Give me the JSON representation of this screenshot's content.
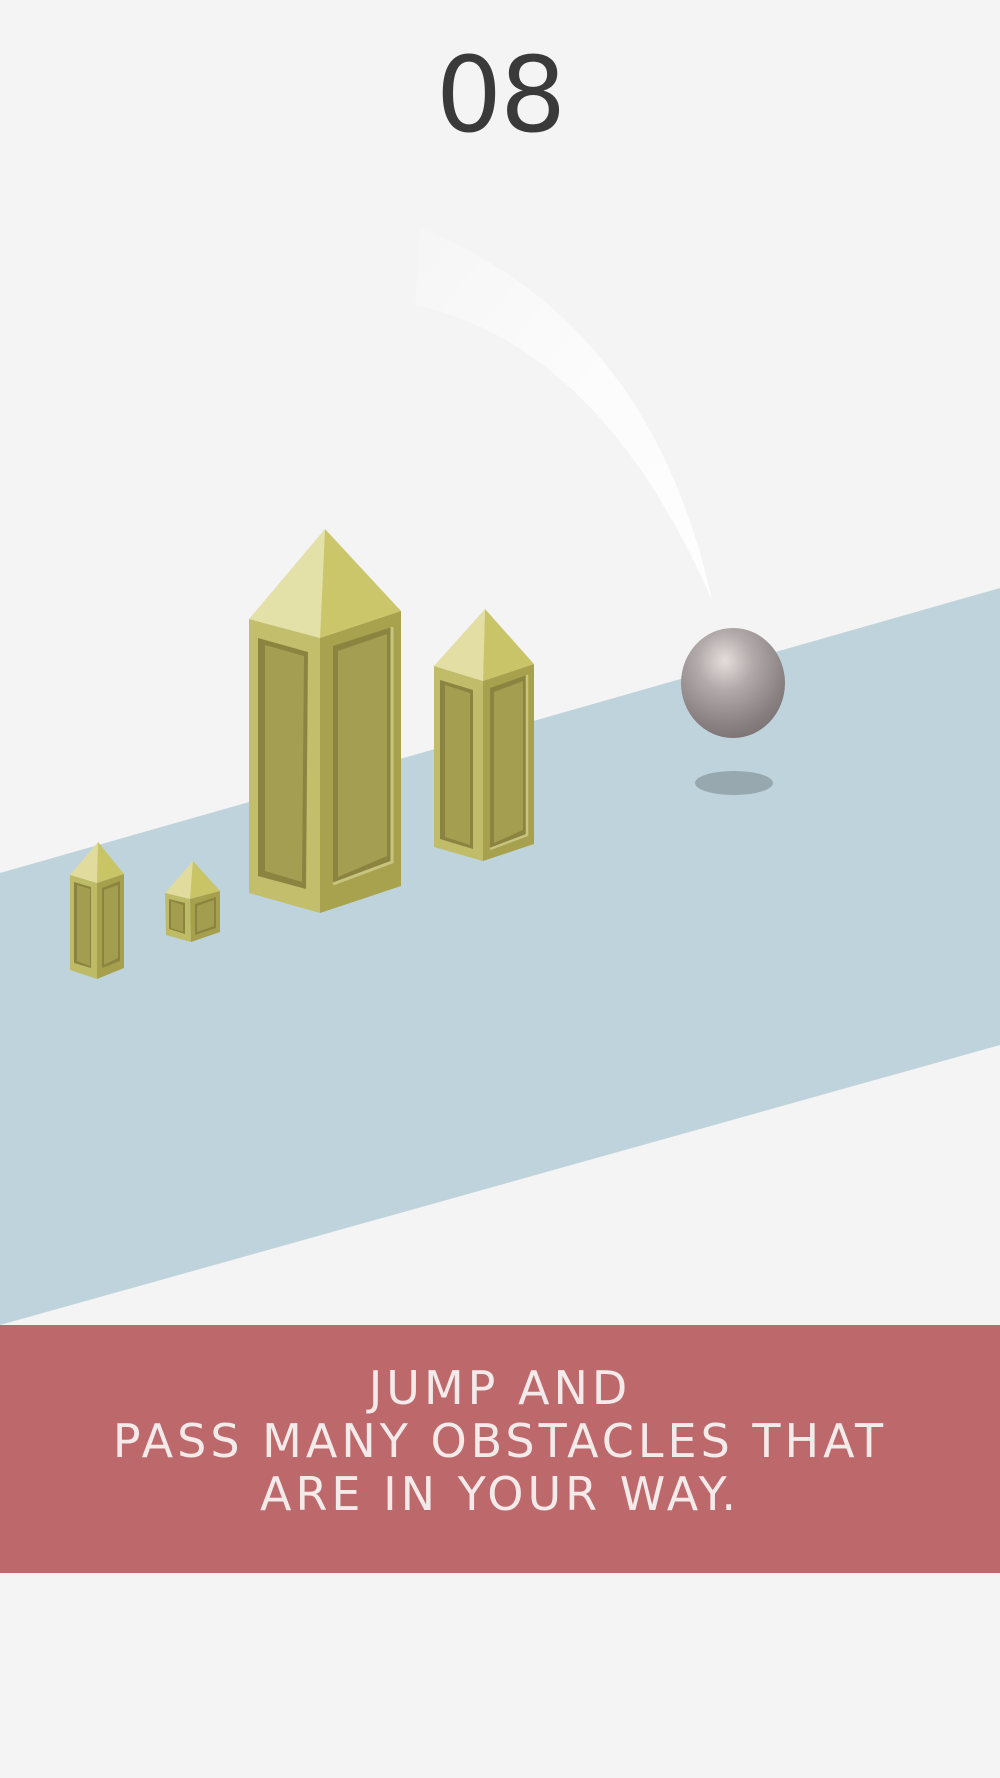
{
  "game": {
    "score": "08",
    "instruction_lines": [
      "JUMP AND",
      "PASS MANY OBSTACLES THAT",
      "ARE IN YOUR WAY."
    ]
  },
  "scene": {
    "track_color": "#bfd3dc",
    "background_color": "#f4f4f4",
    "obstacle_color": "#c7c165",
    "ball_color": "#8a8282",
    "banner_color": "#bd686b",
    "banner_text_color": "#f4eaea",
    "score_color": "#3a3a3a"
  }
}
